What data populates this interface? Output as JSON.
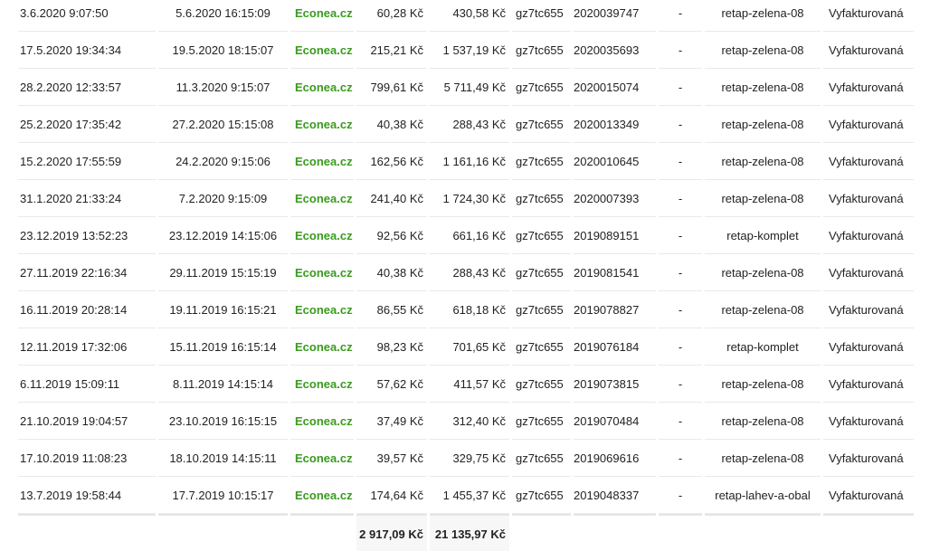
{
  "rows": [
    {
      "created": "3.6.2020 9:07:50",
      "approved": "5.6.2020 16:15:09",
      "partner": "Econea.cz",
      "commission": "60,28 Kč",
      "price": "430,58 Kč",
      "code": "gz7tc655",
      "order": "2020039747",
      "dash": "-",
      "campaign": "retap-zelena-08",
      "status": "Vyfakturovaná"
    },
    {
      "created": "17.5.2020 19:34:34",
      "approved": "19.5.2020 18:15:07",
      "partner": "Econea.cz",
      "commission": "215,21 Kč",
      "price": "1 537,19 Kč",
      "code": "gz7tc655",
      "order": "2020035693",
      "dash": "-",
      "campaign": "retap-zelena-08",
      "status": "Vyfakturovaná"
    },
    {
      "created": "28.2.2020 12:33:57",
      "approved": "11.3.2020 9:15:07",
      "partner": "Econea.cz",
      "commission": "799,61 Kč",
      "price": "5 711,49 Kč",
      "code": "gz7tc655",
      "order": "2020015074",
      "dash": "-",
      "campaign": "retap-zelena-08",
      "status": "Vyfakturovaná"
    },
    {
      "created": "25.2.2020 17:35:42",
      "approved": "27.2.2020 15:15:08",
      "partner": "Econea.cz",
      "commission": "40,38 Kč",
      "price": "288,43 Kč",
      "code": "gz7tc655",
      "order": "2020013349",
      "dash": "-",
      "campaign": "retap-zelena-08",
      "status": "Vyfakturovaná"
    },
    {
      "created": "15.2.2020 17:55:59",
      "approved": "24.2.2020 9:15:06",
      "partner": "Econea.cz",
      "commission": "162,56 Kč",
      "price": "1 161,16 Kč",
      "code": "gz7tc655",
      "order": "2020010645",
      "dash": "-",
      "campaign": "retap-zelena-08",
      "status": "Vyfakturovaná"
    },
    {
      "created": "31.1.2020 21:33:24",
      "approved": "7.2.2020 9:15:09",
      "partner": "Econea.cz",
      "commission": "241,40 Kč",
      "price": "1 724,30 Kč",
      "code": "gz7tc655",
      "order": "2020007393",
      "dash": "-",
      "campaign": "retap-zelena-08",
      "status": "Vyfakturovaná"
    },
    {
      "created": "23.12.2019 13:52:23",
      "approved": "23.12.2019 14:15:06",
      "partner": "Econea.cz",
      "commission": "92,56 Kč",
      "price": "661,16 Kč",
      "code": "gz7tc655",
      "order": "2019089151",
      "dash": "-",
      "campaign": "retap-komplet",
      "status": "Vyfakturovaná"
    },
    {
      "created": "27.11.2019 22:16:34",
      "approved": "29.11.2019 15:15:19",
      "partner": "Econea.cz",
      "commission": "40,38 Kč",
      "price": "288,43 Kč",
      "code": "gz7tc655",
      "order": "2019081541",
      "dash": "-",
      "campaign": "retap-zelena-08",
      "status": "Vyfakturovaná"
    },
    {
      "created": "16.11.2019 20:28:14",
      "approved": "19.11.2019 16:15:21",
      "partner": "Econea.cz",
      "commission": "86,55 Kč",
      "price": "618,18 Kč",
      "code": "gz7tc655",
      "order": "2019078827",
      "dash": "-",
      "campaign": "retap-zelena-08",
      "status": "Vyfakturovaná"
    },
    {
      "created": "12.11.2019 17:32:06",
      "approved": "15.11.2019 16:15:14",
      "partner": "Econea.cz",
      "commission": "98,23 Kč",
      "price": "701,65 Kč",
      "code": "gz7tc655",
      "order": "2019076184",
      "dash": "-",
      "campaign": "retap-komplet",
      "status": "Vyfakturovaná"
    },
    {
      "created": "6.11.2019 15:09:11",
      "approved": "8.11.2019 14:15:14",
      "partner": "Econea.cz",
      "commission": "57,62 Kč",
      "price": "411,57 Kč",
      "code": "gz7tc655",
      "order": "2019073815",
      "dash": "-",
      "campaign": "retap-zelena-08",
      "status": "Vyfakturovaná"
    },
    {
      "created": "21.10.2019 19:04:57",
      "approved": "23.10.2019 16:15:15",
      "partner": "Econea.cz",
      "commission": "37,49 Kč",
      "price": "312,40 Kč",
      "code": "gz7tc655",
      "order": "2019070484",
      "dash": "-",
      "campaign": "retap-zelena-08",
      "status": "Vyfakturovaná"
    },
    {
      "created": "17.10.2019 11:08:23",
      "approved": "18.10.2019 14:15:11",
      "partner": "Econea.cz",
      "commission": "39,57 Kč",
      "price": "329,75 Kč",
      "code": "gz7tc655",
      "order": "2019069616",
      "dash": "-",
      "campaign": "retap-zelena-08",
      "status": "Vyfakturovaná"
    },
    {
      "created": "13.7.2019 19:58:44",
      "approved": "17.7.2019 10:15:17",
      "partner": "Econea.cz",
      "commission": "174,64 Kč",
      "price": "1 455,37 Kč",
      "code": "gz7tc655",
      "order": "2019048337",
      "dash": "-",
      "campaign": "retap-lahev-a-obal",
      "status": "Vyfakturovaná"
    }
  ],
  "totals": {
    "commission": "2 917,09 Kč",
    "price": "21 135,97 Kč"
  },
  "colors": {
    "partner_green": "#3a9b1f",
    "row_border": "#e9e9e9",
    "total_background": "#f7f7f7"
  }
}
